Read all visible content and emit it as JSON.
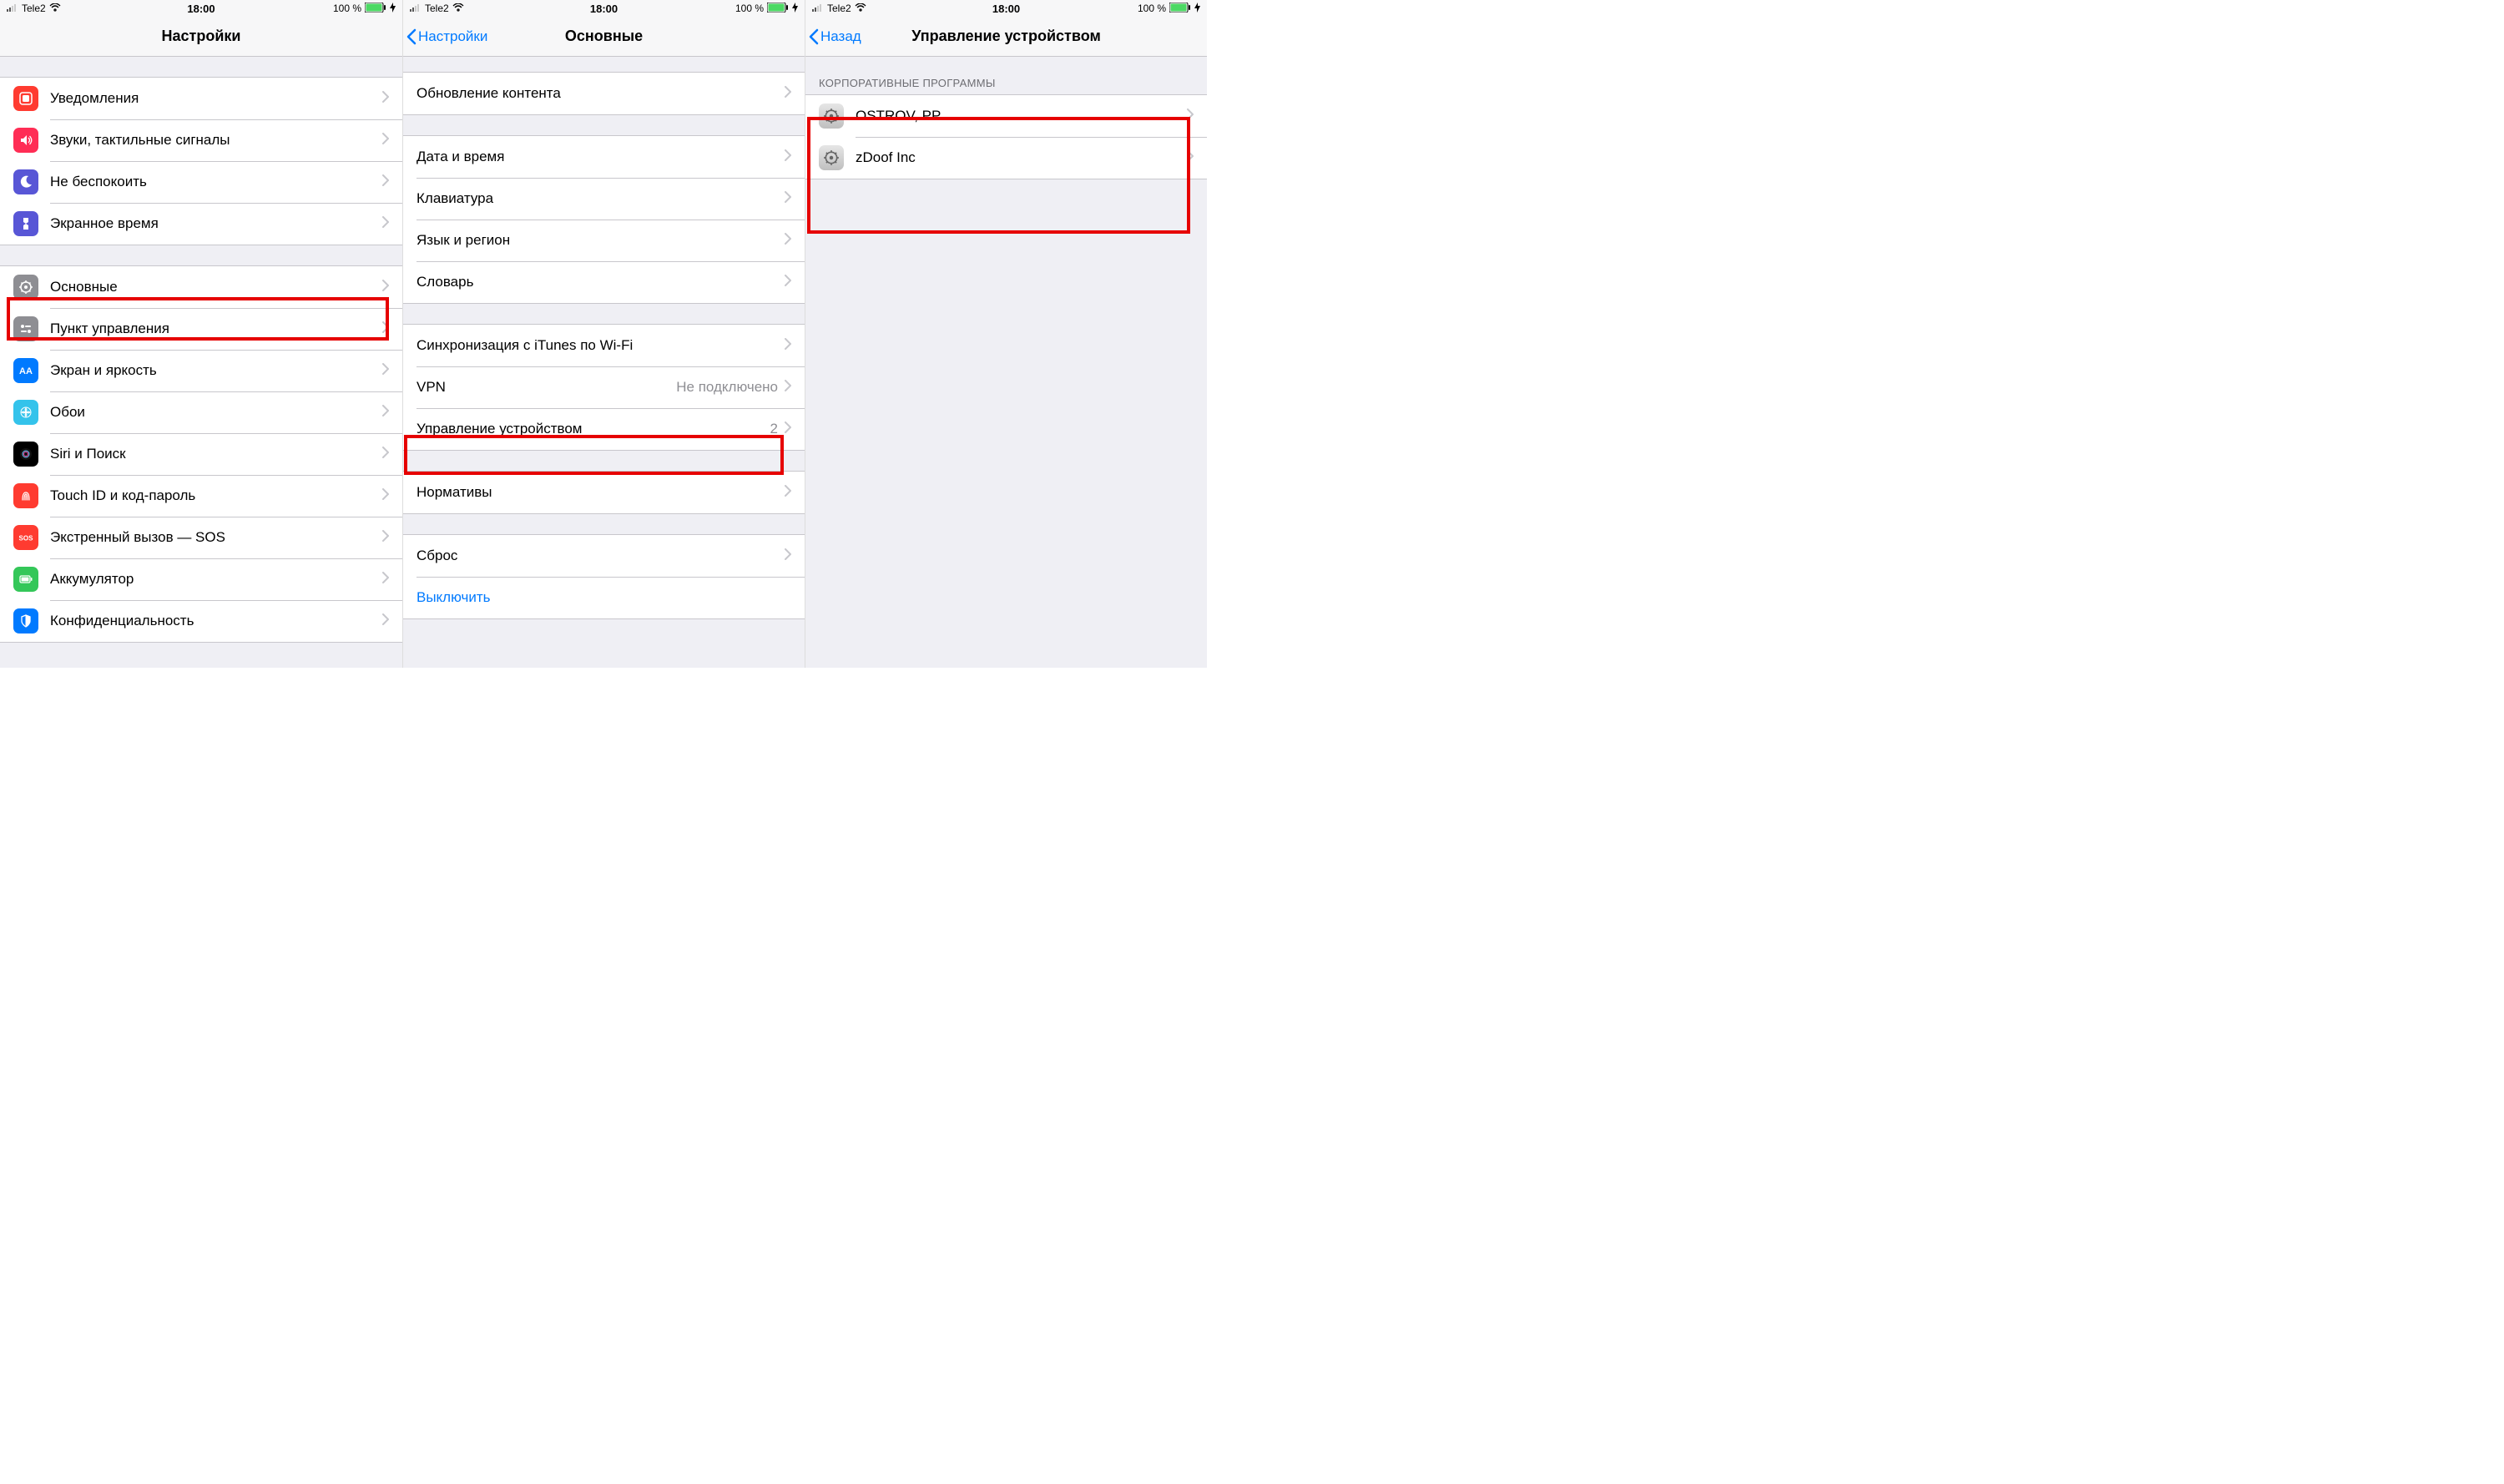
{
  "status": {
    "carrier": "Tele2",
    "time": "18:00",
    "battery": "100 %"
  },
  "screen1": {
    "title": "Настройки",
    "group1": [
      {
        "label": "Уведомления",
        "icon": "notifications",
        "bg": "#ff3b30"
      },
      {
        "label": "Звуки, тактильные сигналы",
        "icon": "sounds",
        "bg": "#ff2d55"
      },
      {
        "label": "Не беспокоить",
        "icon": "dnd",
        "bg": "#5856d6"
      },
      {
        "label": "Экранное время",
        "icon": "screentime",
        "bg": "#5856d6"
      }
    ],
    "group2": [
      {
        "label": "Основные",
        "icon": "general",
        "bg": "#8e8e93"
      },
      {
        "label": "Пункт управления",
        "icon": "control",
        "bg": "#8e8e93"
      },
      {
        "label": "Экран и яркость",
        "icon": "display",
        "bg": "#007aff"
      },
      {
        "label": "Обои",
        "icon": "wallpaper",
        "bg": "#34c3eb"
      },
      {
        "label": "Siri и Поиск",
        "icon": "siri",
        "bg": "#000"
      },
      {
        "label": "Touch ID и код-пароль",
        "icon": "touchid",
        "bg": "#ff3b30"
      },
      {
        "label": "Экстренный вызов — SOS",
        "icon": "sos",
        "bg": "#ff3b30"
      },
      {
        "label": "Аккумулятор",
        "icon": "battery",
        "bg": "#34c759"
      },
      {
        "label": "Конфиденциальность",
        "icon": "privacy",
        "bg": "#007aff"
      }
    ]
  },
  "screen2": {
    "back": "Настройки",
    "title": "Основные",
    "group1": [
      {
        "label": "Обновление контента"
      }
    ],
    "group2": [
      {
        "label": "Дата и время"
      },
      {
        "label": "Клавиатура"
      },
      {
        "label": "Язык и регион"
      },
      {
        "label": "Словарь"
      }
    ],
    "group3": [
      {
        "label": "Синхронизация с iTunes по Wi-Fi"
      },
      {
        "label": "VPN",
        "value": "Не подключено"
      },
      {
        "label": "Управление устройством",
        "value": "2"
      }
    ],
    "group4": [
      {
        "label": "Нормативы"
      }
    ],
    "group5": [
      {
        "label": "Сброс"
      },
      {
        "label": "Выключить",
        "link": true,
        "noChevron": true
      }
    ]
  },
  "screen3": {
    "back": "Назад",
    "title": "Управление устройством",
    "sectionHeader": "КОРПОРАТИВНЫЕ ПРОГРАММЫ",
    "profiles": [
      {
        "label": "OSTROV, PP"
      },
      {
        "label": "zDoof Inc"
      }
    ]
  }
}
